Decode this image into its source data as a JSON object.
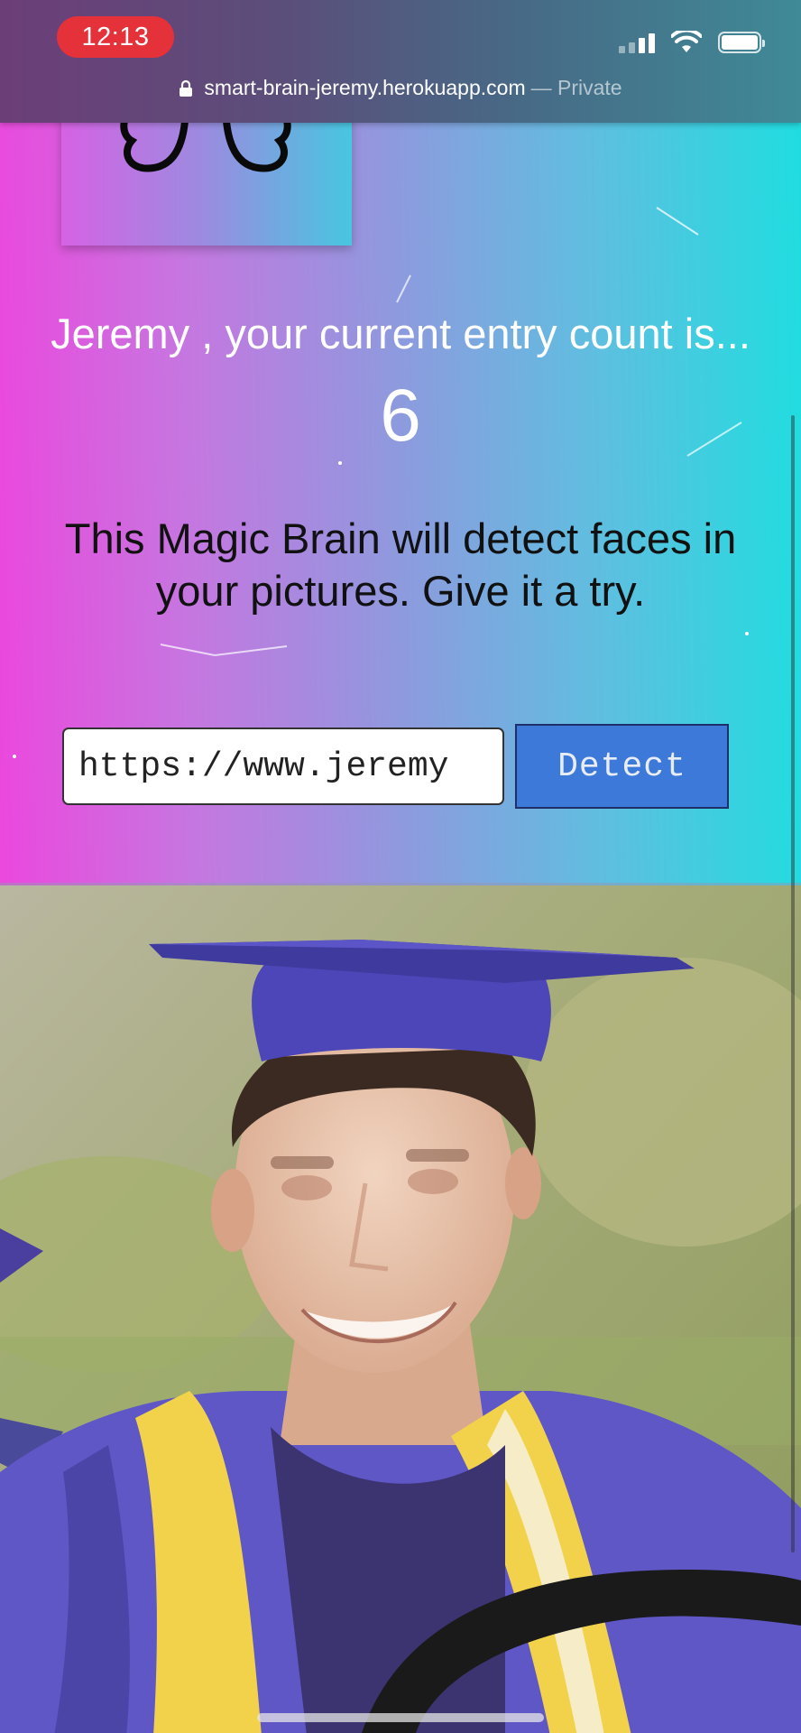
{
  "status_bar": {
    "time": "12:13",
    "icons": [
      "cellular-signal-icon",
      "wifi-icon",
      "battery-icon"
    ],
    "time_pill_color": "#e5313a"
  },
  "url_bar": {
    "domain": "smart-brain-jeremy.herokuapp.com",
    "mode": "— Private",
    "icon": "lock-icon"
  },
  "logo": {
    "icon": "brain-icon"
  },
  "rank": {
    "greeting": "Jeremy , your current entry count is...",
    "count": "6"
  },
  "intro": {
    "text": "This Magic Brain will detect faces in your pictures. Give it a try."
  },
  "form": {
    "url_value": "https://www.jeremy",
    "detect_label": "Detect",
    "button_color": "#3d79d8"
  },
  "photo": {
    "subject": "graduate-photo"
  },
  "theme": {
    "gradient_left": "#ee44dd",
    "gradient_right": "#1fdde0"
  }
}
